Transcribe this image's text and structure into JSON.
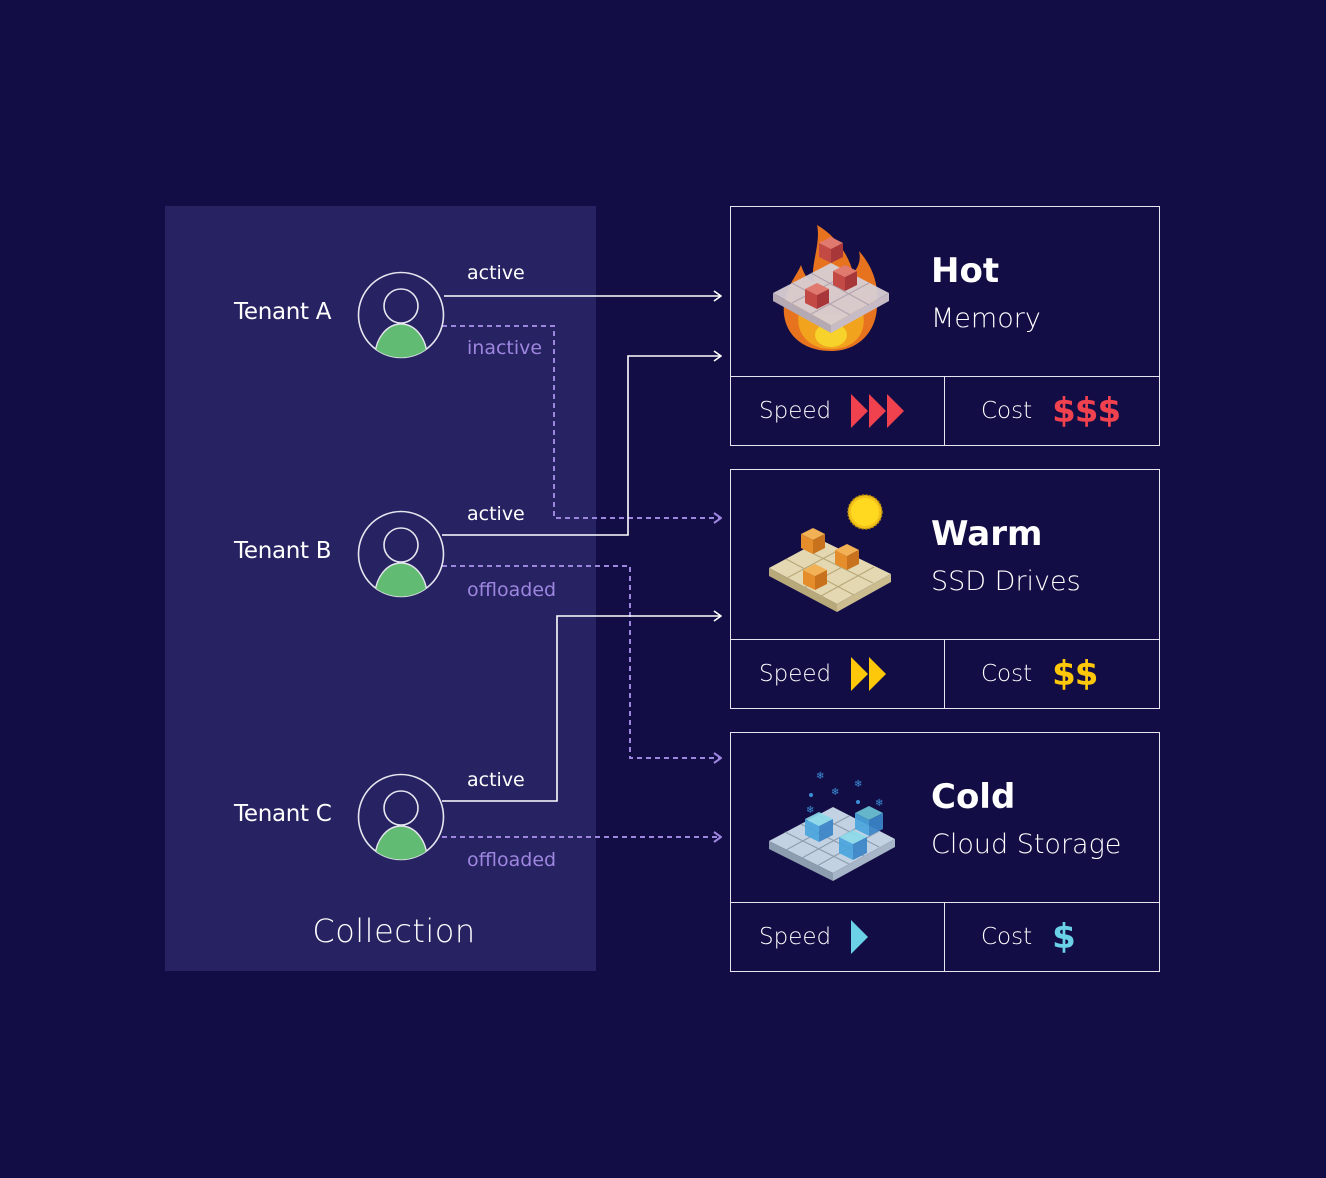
{
  "collection": {
    "label": "Collection",
    "tenants": [
      {
        "name": "Tenant A",
        "edges": [
          {
            "label": "active",
            "style": "solid",
            "target": "Hot"
          },
          {
            "label": "inactive",
            "style": "dashed",
            "target": "Warm"
          }
        ]
      },
      {
        "name": "Tenant B",
        "edges": [
          {
            "label": "active",
            "style": "solid",
            "target": "Hot"
          },
          {
            "label": "offloaded",
            "style": "dashed",
            "target": "Cold"
          }
        ]
      },
      {
        "name": "Tenant C",
        "edges": [
          {
            "label": "active",
            "style": "solid",
            "target": "Warm"
          },
          {
            "label": "offloaded",
            "style": "dashed",
            "target": "Cold"
          }
        ]
      }
    ]
  },
  "tiers": [
    {
      "name": "Hot",
      "medium": "Memory",
      "illustration": "fire-icon",
      "speed_label": "Speed",
      "speed_level": 3,
      "cost_label": "Cost",
      "cost": "$$$",
      "accent": "#f0414f"
    },
    {
      "name": "Warm",
      "medium": "SSD Drives",
      "illustration": "sun-icon",
      "speed_label": "Speed",
      "speed_level": 2,
      "cost_label": "Cost",
      "cost": "$$",
      "accent": "#fdc80a"
    },
    {
      "name": "Cold",
      "medium": "Cloud Storage",
      "illustration": "snowflake-icon",
      "speed_label": "Speed",
      "speed_level": 1,
      "cost_label": "Cost",
      "cost": "$",
      "accent": "#6bd1e6"
    }
  ],
  "colors": {
    "background": "#130d45",
    "collection_panel": "#272261",
    "solid_line": "#ffffff",
    "dashed_line": "#9d86e0",
    "avatar_body": "#62bb72"
  }
}
